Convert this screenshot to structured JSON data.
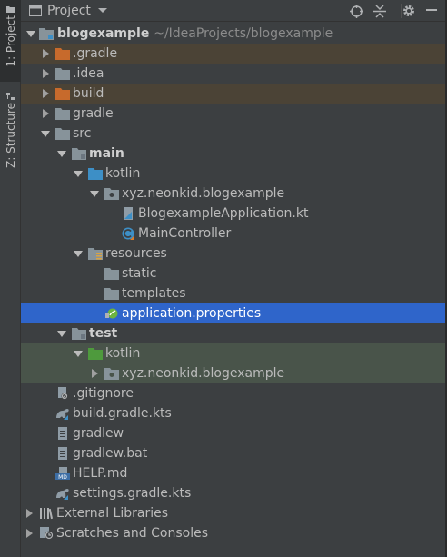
{
  "stripe": {
    "project_tab": "1: Project",
    "structure_tab": "Z: Structure"
  },
  "header": {
    "title": "Project",
    "icons": [
      "project-icon",
      "chevron-down-icon",
      "locate-icon",
      "collapse-all-icon",
      "gear-icon",
      "hide-icon"
    ]
  },
  "tree": [
    {
      "label": "blogexample",
      "path": "~/IdeaProjects/blogexample",
      "icon": "module-folder-icon",
      "expanded": true,
      "bold": true
    },
    {
      "label": ".gradle",
      "icon": "excluded-folder-icon",
      "expanded": false
    },
    {
      "label": ".idea",
      "icon": "folder-icon",
      "expanded": false
    },
    {
      "label": "build",
      "icon": "excluded-folder-icon",
      "expanded": false
    },
    {
      "label": "gradle",
      "icon": "folder-icon",
      "expanded": false
    },
    {
      "label": "src",
      "icon": "folder-icon",
      "expanded": true
    },
    {
      "label": "main",
      "icon": "module-folder-icon",
      "expanded": true,
      "bold": true
    },
    {
      "label": "kotlin",
      "icon": "source-root-icon",
      "expanded": true
    },
    {
      "label": "xyz.neonkid.blogexample",
      "icon": "package-icon",
      "expanded": true
    },
    {
      "label": "BlogexampleApplication.kt",
      "icon": "kotlin-file-icon"
    },
    {
      "label": "MainController",
      "icon": "kotlin-class-icon"
    },
    {
      "label": "resources",
      "icon": "resources-root-icon",
      "expanded": true
    },
    {
      "label": "static",
      "icon": "folder-icon"
    },
    {
      "label": "templates",
      "icon": "folder-icon"
    },
    {
      "label": "application.properties",
      "icon": "spring-properties-icon",
      "selected": true
    },
    {
      "label": "test",
      "icon": "module-folder-icon",
      "expanded": true,
      "bold": true
    },
    {
      "label": "kotlin",
      "icon": "test-root-icon",
      "expanded": true
    },
    {
      "label": "xyz.neonkid.blogexample",
      "icon": "package-icon",
      "expanded": false
    },
    {
      "label": ".gitignore",
      "icon": "gitignore-icon"
    },
    {
      "label": "build.gradle.kts",
      "icon": "gradle-kts-icon"
    },
    {
      "label": "gradlew",
      "icon": "text-file-icon"
    },
    {
      "label": "gradlew.bat",
      "icon": "text-file-icon"
    },
    {
      "label": "HELP.md",
      "icon": "markdown-icon"
    },
    {
      "label": "settings.gradle.kts",
      "icon": "gradle-kts-icon"
    },
    {
      "label": "External Libraries",
      "icon": "libraries-icon",
      "expanded": false
    },
    {
      "label": "Scratches and Consoles",
      "icon": "scratches-icon",
      "expanded": false
    }
  ],
  "colors": {
    "background": "#3c3f41",
    "selection": "#2f65ca",
    "excluded_bg": "#4b4336",
    "test_bg": "#49544a",
    "folder": "#87939a",
    "excluded_folder": "#c76a2c",
    "source_root": "#3d8fc6",
    "test_root": "#4e9a3d"
  }
}
